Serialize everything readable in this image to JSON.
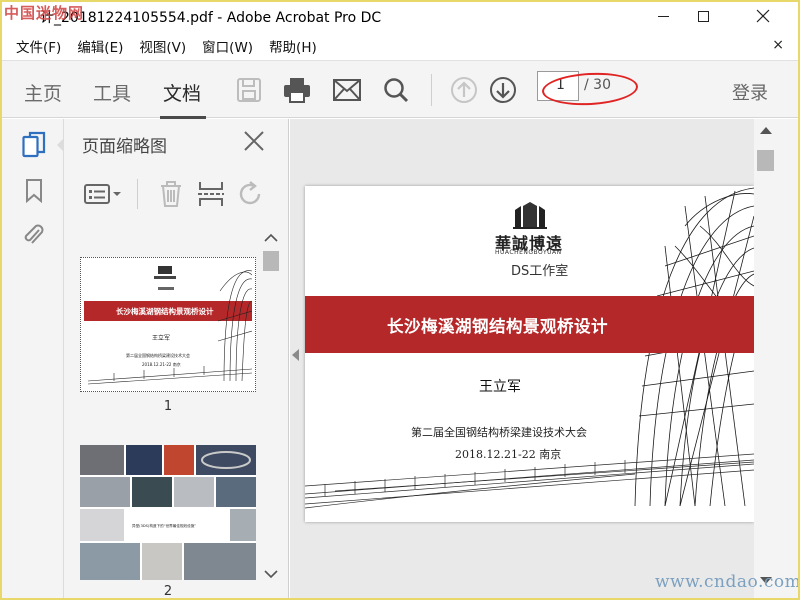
{
  "watermark_top": "中国迷物网",
  "window": {
    "title": "计_20181224105554.pdf - Adobe Acrobat Pro DC",
    "minimize_glyph": "—",
    "maximize_glyph": "☐",
    "close_glyph": "✕"
  },
  "menu": {
    "items": [
      "文件(F)",
      "编辑(E)",
      "视图(V)",
      "窗口(W)",
      "帮助(H)"
    ],
    "close_glyph": "×"
  },
  "toolbar": {
    "tabs": [
      "主页",
      "工具",
      "文档"
    ],
    "active_tab": "文档",
    "icons": [
      "save-icon",
      "print-icon",
      "email-icon",
      "search-icon",
      "page-up-icon",
      "page-down-icon"
    ],
    "page_current": "1",
    "page_total": "/ 30",
    "login_label": "登录"
  },
  "left_rail": {
    "icons": [
      "page-thumbnails-icon",
      "bookmark-icon",
      "attachment-icon"
    ]
  },
  "thumbnails_panel": {
    "title": "页面缩略图",
    "tools": [
      "thumbnail-options-icon",
      "delete-page-icon",
      "extract-page-icon",
      "rotate-page-icon"
    ],
    "pages": [
      {
        "label": "1"
      },
      {
        "label": "2"
      }
    ]
  },
  "document": {
    "brand_cn": "華誠博遠",
    "brand_en": "HUACHENGBOYUAN",
    "studio": "DS工作室",
    "title": "长沙梅溪湖钢结构景观桥设计",
    "author": "王立军",
    "conference": "第二届全国钢结构桥梁建设技术大会",
    "date": "2018.12.21-22   南京",
    "thumb2_caption": "异型(3DS)构造下的“世界最佳规划设施”"
  },
  "watermark_bottom": "www.cndao.com",
  "colors": {
    "accent_red": "#b5282a",
    "highlight_oval": "#e02424",
    "toolbar_bg": "#f4f4f4"
  }
}
